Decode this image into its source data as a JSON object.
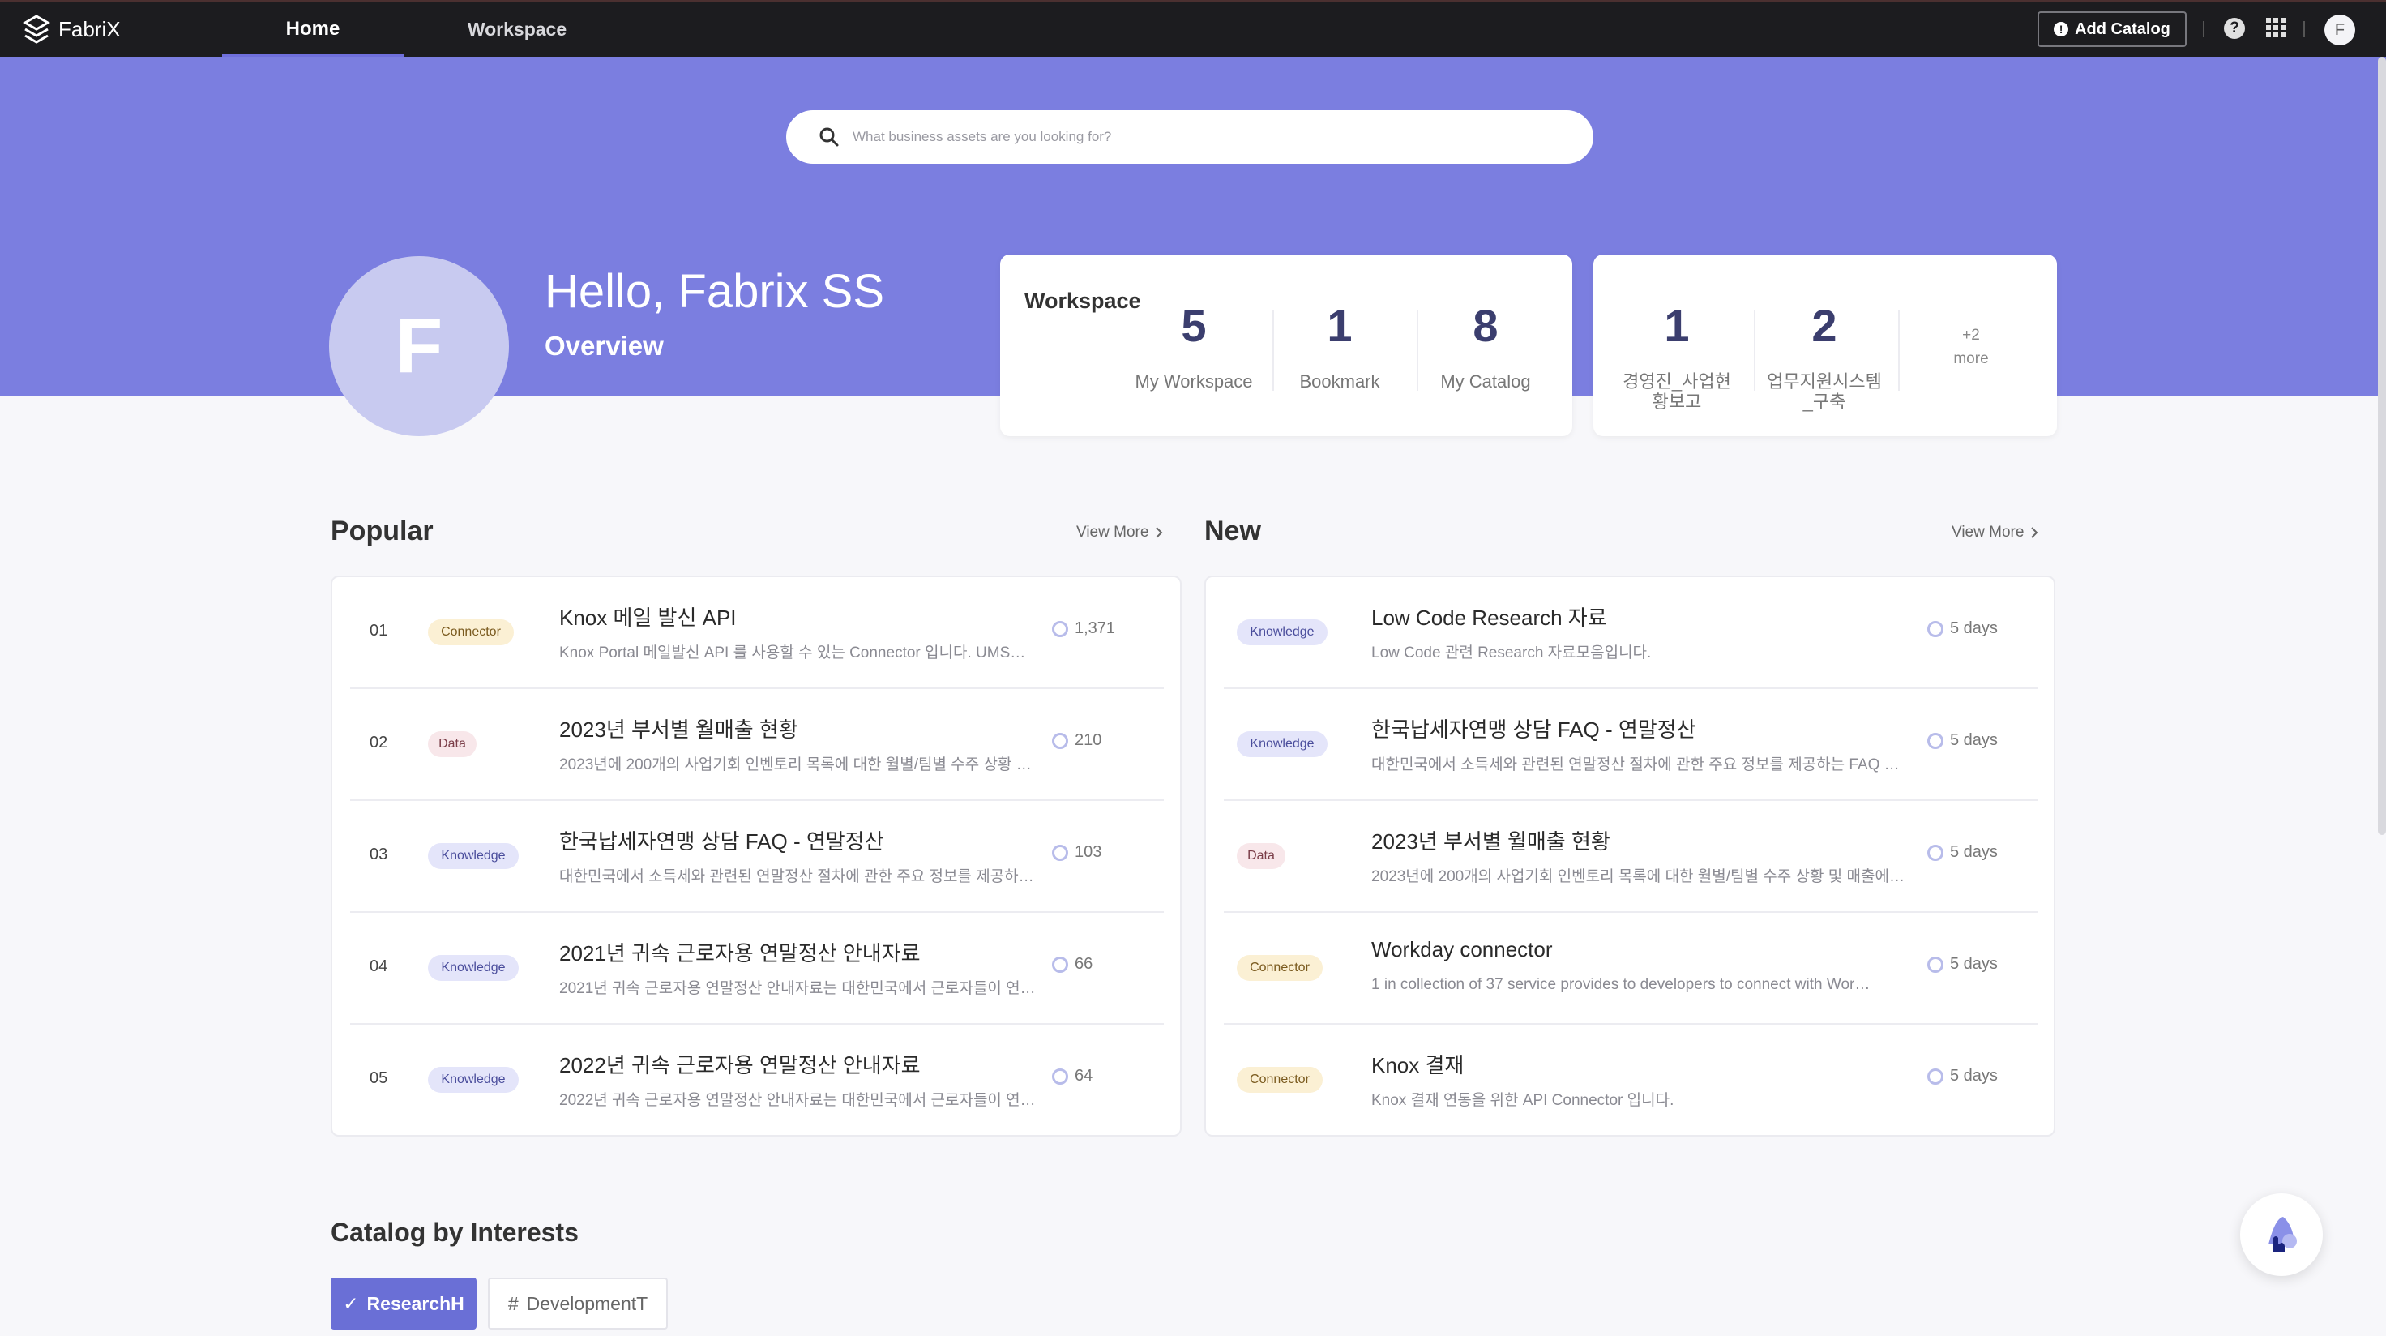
{
  "app": {
    "name": "FabriX"
  },
  "nav": {
    "home": "Home",
    "workspace": "Workspace"
  },
  "header": {
    "add_catalog": "Add Catalog",
    "help_icon": "?",
    "user_initial": "F"
  },
  "search": {
    "placeholder": "What business assets are you looking for?"
  },
  "profile": {
    "initial": "F",
    "greeting": "Hello, Fabrix SS",
    "subtitle": "Overview"
  },
  "workspace_card": {
    "title": "Workspace",
    "stats": [
      {
        "value": "5",
        "label": "My Workspace"
      },
      {
        "value": "1",
        "label": "Bookmark"
      },
      {
        "value": "8",
        "label": "My Catalog"
      }
    ]
  },
  "project_card": {
    "stats": [
      {
        "value": "1",
        "label_line1": "경영진_사업현",
        "label_line2": "황보고"
      },
      {
        "value": "2",
        "label_line1": "업무지원시스템",
        "label_line2": "_구축"
      }
    ],
    "more_count": "+2",
    "more_label": "more"
  },
  "popular": {
    "title": "Popular",
    "view_more": "View More",
    "items": [
      {
        "rank": "01",
        "tag": "Connector",
        "title": "Knox 메일 발신 API",
        "desc": "Knox Portal  메일발신 API 를 사용할 수 있는 Connector 입니다.  UMS…",
        "count": "1,371"
      },
      {
        "rank": "02",
        "tag": "Data",
        "title": "2023년 부서별 월매출 현황",
        "desc": "2023년에 200개의 사업기회 인벤토리 목록에 대한 월별/팀별 수주 상황 …",
        "count": "210"
      },
      {
        "rank": "03",
        "tag": "Knowledge",
        "title": "한국납세자연맹 상담 FAQ - 연말정산",
        "desc": "대한민국에서 소득세와 관련된 연말정산 절차에 관한 주요 정보를 제공하…",
        "count": "103"
      },
      {
        "rank": "04",
        "tag": "Knowledge",
        "title": "2021년 귀속 근로자용 연말정산 안내자료",
        "desc": "2021년 귀속 근로자용 연말정산 안내자료는 대한민국에서 근로자들이 연…",
        "count": "66"
      },
      {
        "rank": "05",
        "tag": "Knowledge",
        "title": "2022년 귀속 근로자용 연말정산 안내자료",
        "desc": "2022년 귀속 근로자용 연말정산 안내자료는 대한민국에서 근로자들이 연…",
        "count": "64"
      }
    ]
  },
  "new": {
    "title": "New",
    "view_more": "View More",
    "items": [
      {
        "tag": "Knowledge",
        "title": "Low Code Research 자료",
        "desc": "Low Code 관련 Research 자료모음입니다.",
        "age": "5 days"
      },
      {
        "tag": "Knowledge",
        "title": "한국납세자연맹 상담 FAQ - 연말정산",
        "desc": "대한민국에서 소득세와 관련된 연말정산 절차에 관한 주요 정보를 제공하는 FAQ …",
        "age": "5 days"
      },
      {
        "tag": "Data",
        "title": "2023년 부서별 월매출 현황",
        "desc": "2023년에 200개의 사업기회 인벤토리 목록에 대한 월별/팀별 수주 상황 및 매출에…",
        "age": "5 days"
      },
      {
        "tag": "Connector",
        "title": "Workday connector",
        "desc": "1 in collection of 37 service provides to developers to connect with Wor…",
        "age": "5 days"
      },
      {
        "tag": "Connector",
        "title": "Knox 결재",
        "desc": "Knox 결재 연동을 위한 API Connector 입니다.",
        "age": "5 days"
      }
    ]
  },
  "interests": {
    "title": "Catalog by Interests",
    "chips": [
      {
        "label": "ResearchH",
        "active": true
      },
      {
        "label": "DevelopmentT",
        "active": false
      }
    ]
  },
  "colors": {
    "hero": "#7b7ee0",
    "accent": "#6a6fd6",
    "topbar": "#1c1c1f"
  }
}
